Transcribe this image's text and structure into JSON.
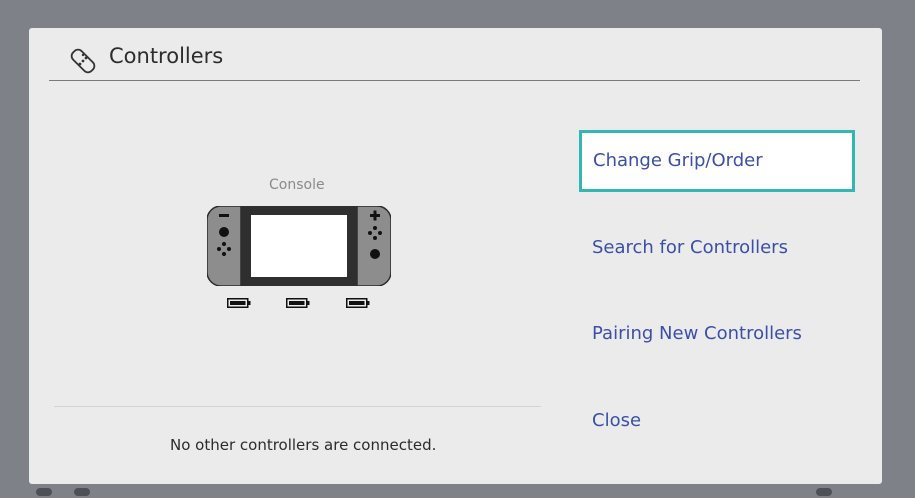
{
  "header": {
    "title": "Controllers",
    "icon": "controller-icon"
  },
  "console": {
    "label": "Console",
    "icon": "switch-console-icon",
    "batteries": [
      "battery-icon",
      "battery-icon",
      "battery-icon"
    ]
  },
  "status": {
    "message": "No other controllers are connected."
  },
  "menu": {
    "items": [
      {
        "label": "Change Grip/Order",
        "selected": true
      },
      {
        "label": "Search for Controllers",
        "selected": false
      },
      {
        "label": "Pairing New Controllers",
        "selected": false
      },
      {
        "label": "Close",
        "selected": false
      }
    ]
  },
  "colors": {
    "accent": "#33b7b2",
    "menu_text": "#3a4fa8",
    "panel_bg": "#ebebeb",
    "backdrop": "#7e8187"
  }
}
